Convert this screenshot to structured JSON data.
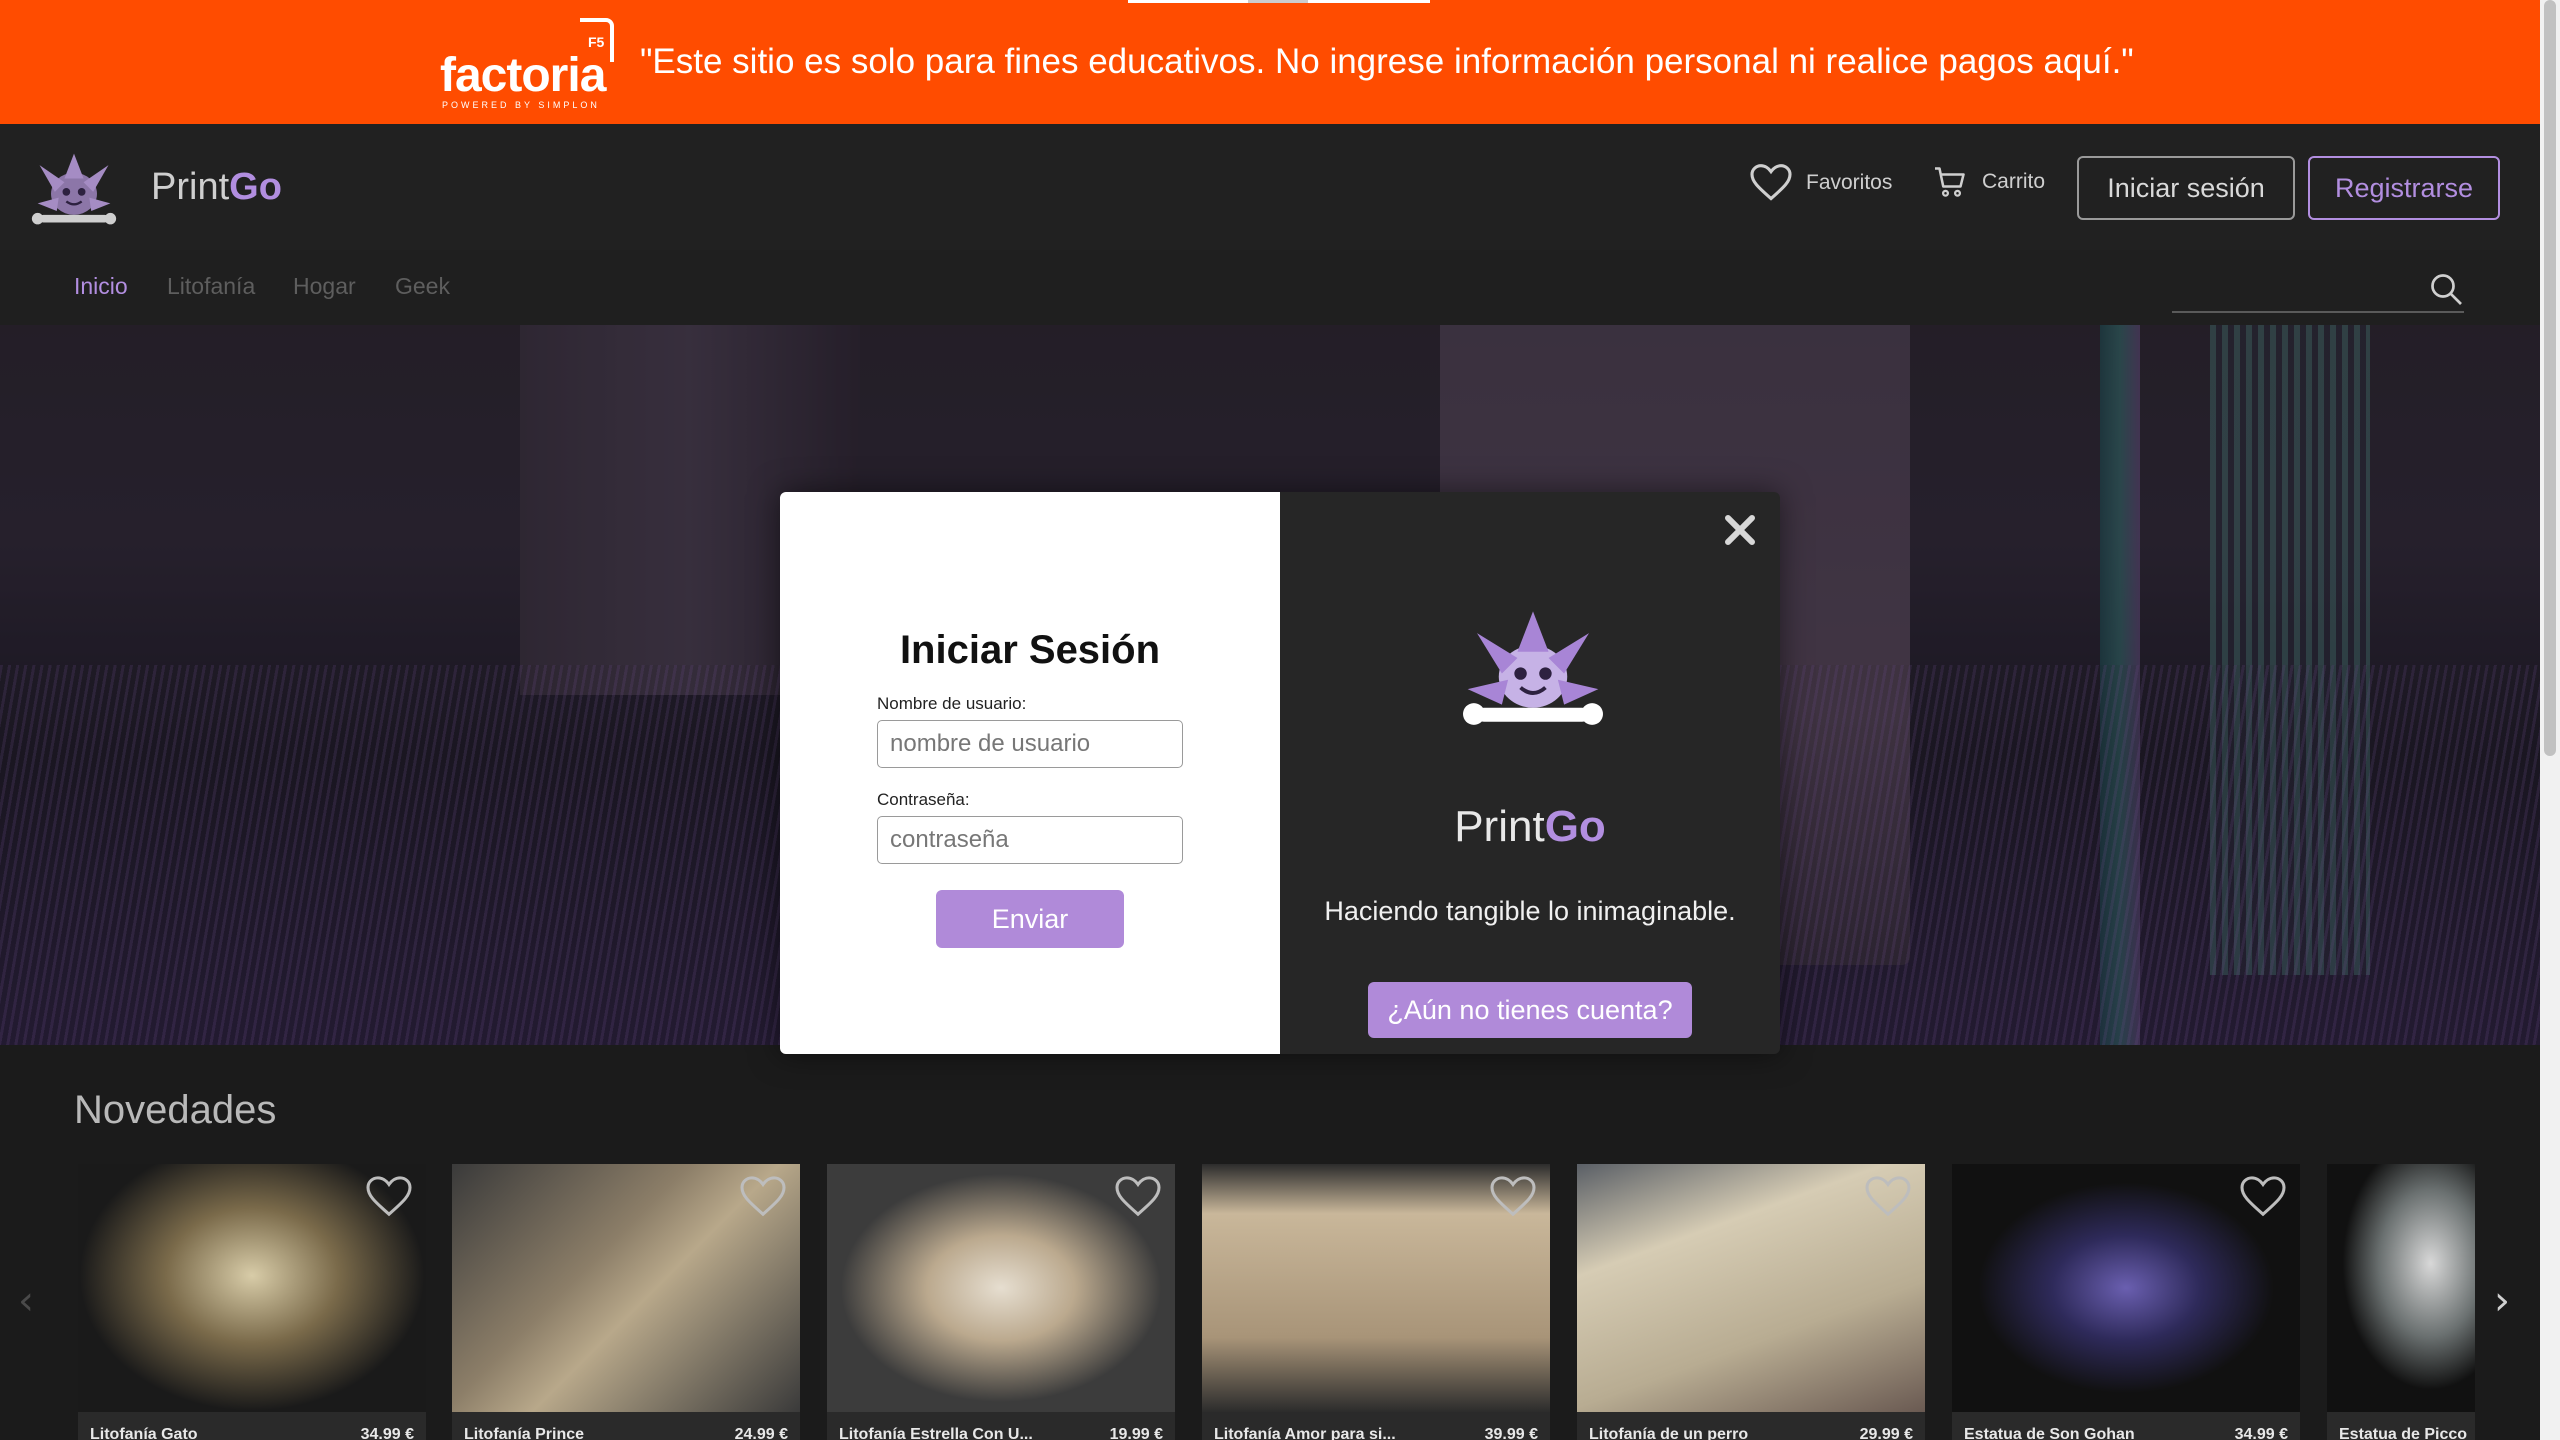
{
  "banner": {
    "logo_word": "factoria",
    "logo_badge": "F5",
    "logo_sub": "POWERED BY SIMPLON",
    "message": "\"Este sitio es solo para fines educativos. No ingrese información personal ni realice pagos aquí.\"",
    "bg_color": "#ff4c00"
  },
  "navbar": {
    "brand_prefix": "Print",
    "brand_suffix": "Go",
    "favorites_label": "Favoritos",
    "cart_label": "Carrito",
    "login_label": "Iniciar sesión",
    "register_label": "Registrarse",
    "accent_color": "#b28ee0"
  },
  "subnav": {
    "items": [
      {
        "label": "Inicio"
      },
      {
        "label": "Litofanía"
      },
      {
        "label": "Hogar"
      },
      {
        "label": "Geek"
      }
    ],
    "search_placeholder": ""
  },
  "section": {
    "title": "Novedades"
  },
  "products": [
    {
      "name": "Litofanía Gato",
      "price": "34.99 €"
    },
    {
      "name": "Litofanía Prince",
      "price": "24.99 €"
    },
    {
      "name": "Litofanía Estrella Con U...",
      "price": "19.99 €"
    },
    {
      "name": "Litofanía Amor para si...",
      "price": "39.99 €"
    },
    {
      "name": "Litofanía de un perro",
      "price": "29.99 €"
    },
    {
      "name": "Estatua de Son Gohan",
      "price": "34.99 €"
    },
    {
      "name": "Estatua de Picco",
      "price": ""
    }
  ],
  "modal": {
    "title": "Iniciar Sesión",
    "username_label": "Nombre de usuario:",
    "username_placeholder": "nombre de usuario",
    "password_label": "Contraseña:",
    "password_placeholder": "contraseña",
    "submit_label": "Enviar",
    "brand_prefix": "Print",
    "brand_suffix": "Go",
    "tagline": "Haciendo tangible lo inimaginable.",
    "signup_label": "¿Aún no tienes cuenta?",
    "button_color": "#b08ad9"
  }
}
